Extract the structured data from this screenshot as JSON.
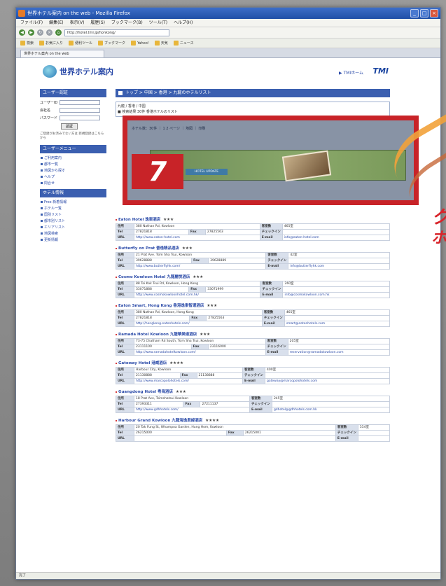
{
  "window": {
    "title": "世界ホテル案内 on the web - Mozilla Firefox",
    "menu": [
      "ファイル(F)",
      "編集(E)",
      "表示(V)",
      "履歴(S)",
      "ブックマーク(B)",
      "ツール(T)",
      "ヘルプ(H)"
    ],
    "url": "http://hotel.tmi.jp/honkong/",
    "bookmarks": [
      "検索",
      "お気に入り",
      "便利ツール",
      "ブックマーク",
      "Yahoo!",
      "天気",
      "ニュース"
    ],
    "tab": "世界ホテル案内 on the web",
    "status": "完了",
    "win_buttons": [
      "_",
      "□",
      "×"
    ]
  },
  "site": {
    "logo": "世界ホテル案内",
    "home_link": "▶ TMIホーム",
    "brand": "TMI"
  },
  "sidebar": {
    "login_head": "ユーザー認証",
    "fields": [
      "ユーザーID",
      "会社名",
      "パスワード"
    ],
    "login_btn": "認証",
    "note": "ご登録がお済みでない方は\n新規登録はこちらから",
    "user_menu_head": "ユーザーメニュー",
    "user_links": [
      "ご利用案内",
      "都市一覧",
      "地図から探す",
      "ヘルプ",
      "問合せ"
    ],
    "info_head": "ホテル情報",
    "info_links": [
      "Free 新着情報",
      "ホテル一覧",
      "国別リスト",
      "都市別リスト",
      "エリアリスト",
      "地図検索",
      "更新情報"
    ]
  },
  "main": {
    "breadcrumb": "トップ > 中国 > 香港 > 九龍のホテルリスト",
    "notice_title": "九龍 / 香港 / 中国",
    "notice_body": "■ 検索結果 30件 香港ホテルのリスト"
  },
  "highlight": {
    "number": "7",
    "banner_btn": "HOTEL UPDATE",
    "toolbar": "ホテル数：30件 ｜ 1 2 ページ ｜ 地図 ｜ 印刷"
  },
  "labels": {
    "address": "住所",
    "tel": "Tel",
    "fax": "Fax",
    "url": "URL",
    "rooms": "客室数",
    "email": "E-mail",
    "checkin": "チェックイン",
    "checkout": "チェックアウト"
  },
  "hotels": [
    {
      "name": "Eaton Hotel 逸東酒店",
      "stars": "★★★",
      "address": "380 Nathan Rd, Kowloon",
      "rooms": "465室",
      "tel": "27821818",
      "fax": "27825563",
      "url": "http://www.eaton-hotel.com",
      "email": "info@eaton-hotel.com"
    },
    {
      "name": "Butterfly on Prat 晋逸精品酒店",
      "stars": "★★★",
      "address": "21 Prat Ave. Tsim Sha Tsui, Kowloon",
      "rooms": "42室",
      "tel": "39628888",
      "fax": "39628889",
      "url": "http://www.butterflyhk.com/",
      "email": "info@butterflyhk.com"
    },
    {
      "name": "Cosmo Kowloon Hotel 九龍麗悦酒店",
      "stars": "★★★",
      "address": "88 Tai Kok Tsui Rd, Kowloon, Hong Kong",
      "rooms": "260室",
      "tel": "33071888",
      "fax": "33071999",
      "url": "http://www.cosmokowloonhotel.com.hk/",
      "email": "info@cosmokowloon.com.hk"
    },
    {
      "name": "Eaton Smart, Hong Kong 香港逸東智選酒店",
      "stars": "★★★",
      "address": "380 Nathan Rd, Kowloon, Hong Kong",
      "rooms": "465室",
      "tel": "27821818",
      "fax": "27825563",
      "url": "http://hongkong.eatonhotels.com/",
      "email": "smart@eatonhotels.com"
    },
    {
      "name": "Ramada Hotel Kowloon 九龍華美達酒店",
      "stars": "★★★",
      "address": "73-75 Chatham Rd South, Tsim Sha Tsui, Kowloon",
      "rooms": "205室",
      "tel": "23111100",
      "fax": "23116000",
      "url": "http://www.ramadahotelkowloon.com/",
      "email": "reservation@ramadakowloon.com"
    },
    {
      "name": "Gateway Hotel 港威酒店",
      "stars": "★★★★",
      "address": "Harbour City, Kowloon",
      "rooms": "400室",
      "tel": "21130888",
      "fax": "21138888",
      "url": "http://www.marcopolohotels.com/",
      "email": "gateway@marcopolohotels.com"
    },
    {
      "name": "Guangdong Hotel 粤海酒店",
      "stars": "★★★",
      "address": "18 Prat Ave, Tsimshatsui Kowloon",
      "rooms": "245室",
      "tel": "27393311",
      "fax": "27211137",
      "url": "http://www.gdhhotels.com/",
      "email": "gdhotel@gdhhotels.com.hk"
    },
    {
      "name": "Harbour Grand Kowloon 九龍海逸君綽酒店",
      "stars": "★★★★",
      "address": "20 Tak Fung St, Whampoa Garden, Hung Hom, Kowloon",
      "rooms": "554室",
      "tel": "26215000",
      "fax": "26215001",
      "url": "",
      "email": ""
    }
  ],
  "side_text": {
    "big": "ク",
    "small": "ホ"
  },
  "colors": {
    "accent": "#c82328",
    "nav": "#3b5fb0",
    "link": "#2a4aa8"
  }
}
